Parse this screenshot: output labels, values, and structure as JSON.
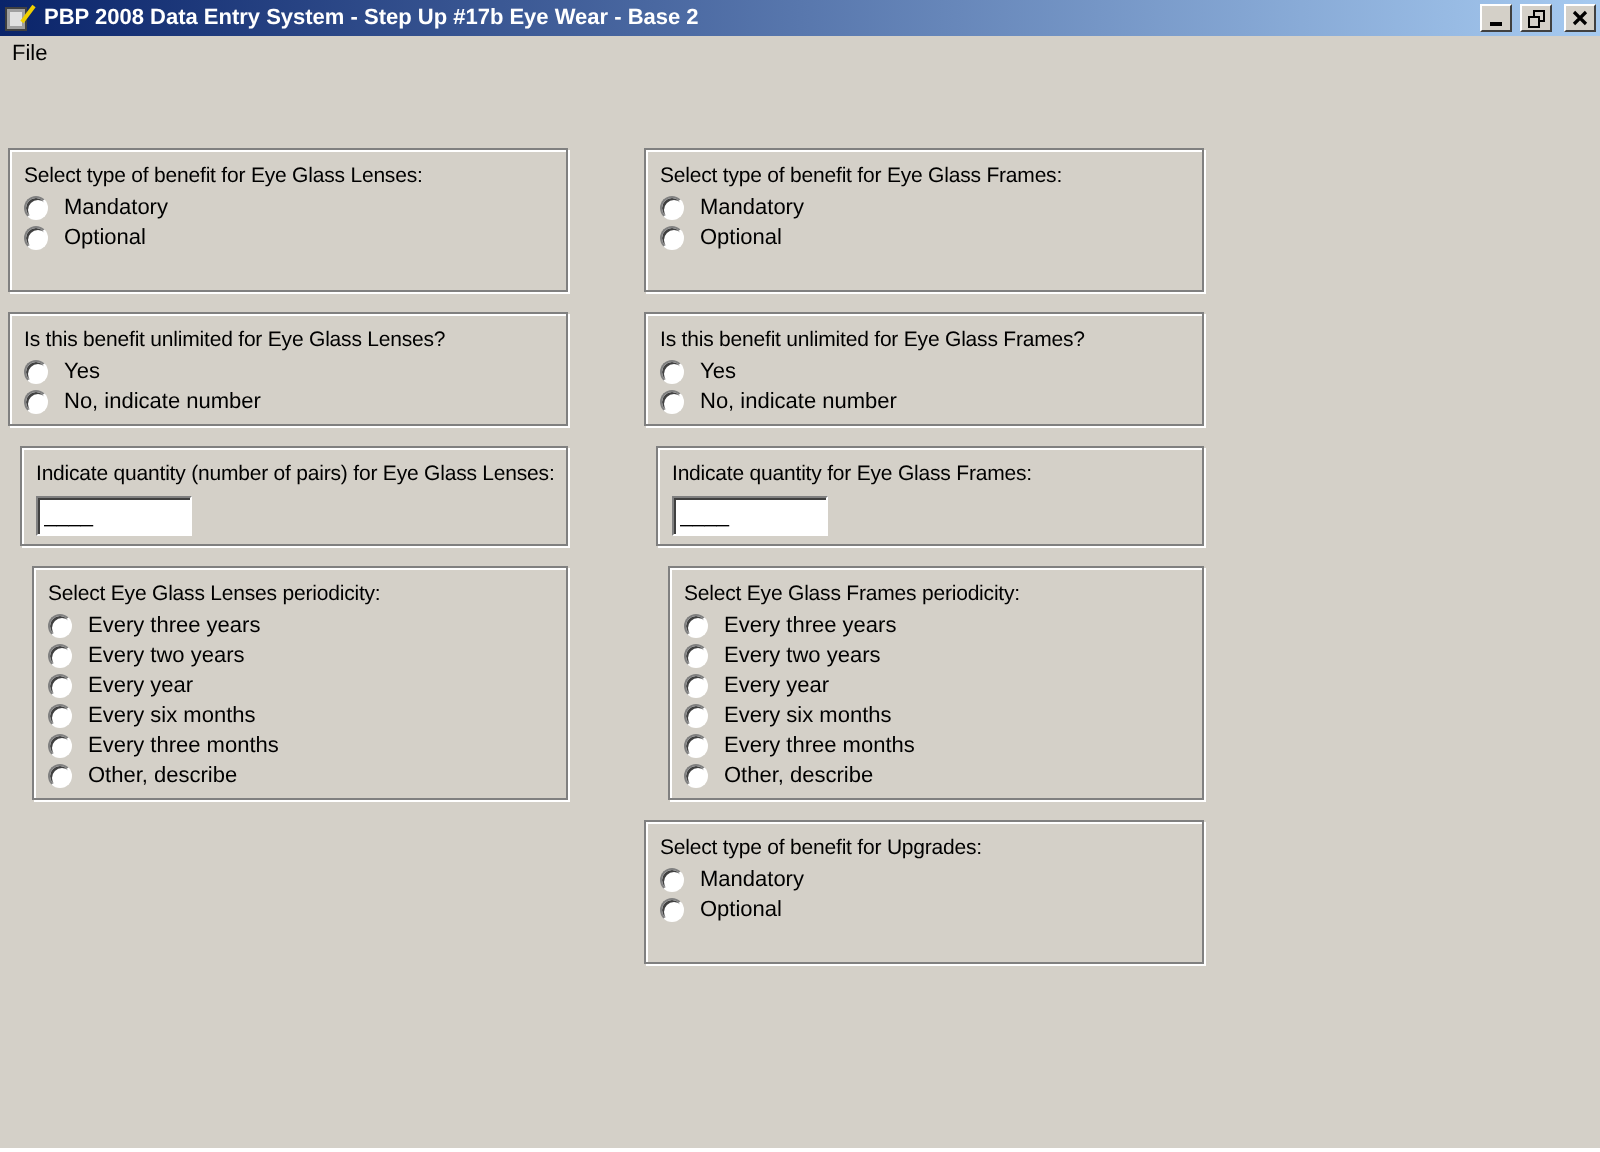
{
  "window": {
    "title": "PBP 2008 Data Entry System - Step Up #17b Eye Wear - Base 2"
  },
  "menu": [
    "File"
  ],
  "columns": [
    {
      "groups": [
        {
          "kind": "type",
          "label": "Select type of benefit for Eye Glass Lenses:",
          "options": [
            {
              "label": "Mandatory",
              "selected": false
            },
            {
              "label": "Optional",
              "selected": false
            }
          ]
        },
        {
          "kind": "unlimited",
          "label": "Is this benefit unlimited for Eye Glass Lenses?",
          "options": [
            {
              "label": "Yes",
              "selected": false
            },
            {
              "label": "No, indicate number",
              "selected": false
            }
          ]
        },
        {
          "kind": "quantity",
          "label": "Indicate quantity (number of pairs) for Eye Glass Lenses:",
          "value": "____"
        },
        {
          "kind": "periodicity",
          "label": "Select Eye Glass Lenses periodicity:",
          "options": [
            {
              "label": "Every three years",
              "selected": false
            },
            {
              "label": "Every two years",
              "selected": false
            },
            {
              "label": "Every year",
              "selected": false
            },
            {
              "label": "Every six months",
              "selected": false
            },
            {
              "label": "Every three months",
              "selected": false
            },
            {
              "label": "Other, describe",
              "selected": false
            }
          ]
        }
      ]
    },
    {
      "groups": [
        {
          "kind": "type",
          "label": "Select type of benefit for Eye Glass Frames:",
          "options": [
            {
              "label": "Mandatory",
              "selected": false
            },
            {
              "label": "Optional",
              "selected": false
            }
          ]
        },
        {
          "kind": "unlimited",
          "label": "Is this benefit unlimited for Eye Glass Frames?",
          "options": [
            {
              "label": "Yes",
              "selected": false
            },
            {
              "label": "No, indicate number",
              "selected": false
            }
          ]
        },
        {
          "kind": "quantity",
          "label": "Indicate quantity for Eye Glass Frames:",
          "value": "____"
        },
        {
          "kind": "periodicity",
          "label": "Select Eye Glass Frames periodicity:",
          "options": [
            {
              "label": "Every three years",
              "selected": false
            },
            {
              "label": "Every two years",
              "selected": false
            },
            {
              "label": "Every year",
              "selected": false
            },
            {
              "label": "Every six months",
              "selected": false
            },
            {
              "label": "Every three months",
              "selected": false
            },
            {
              "label": "Other, describe",
              "selected": false
            }
          ]
        },
        {
          "kind": "type",
          "label": "Select type of benefit for Upgrades:",
          "options": [
            {
              "label": "Mandatory",
              "selected": false
            },
            {
              "label": "Optional",
              "selected": false
            }
          ]
        }
      ]
    }
  ]
}
